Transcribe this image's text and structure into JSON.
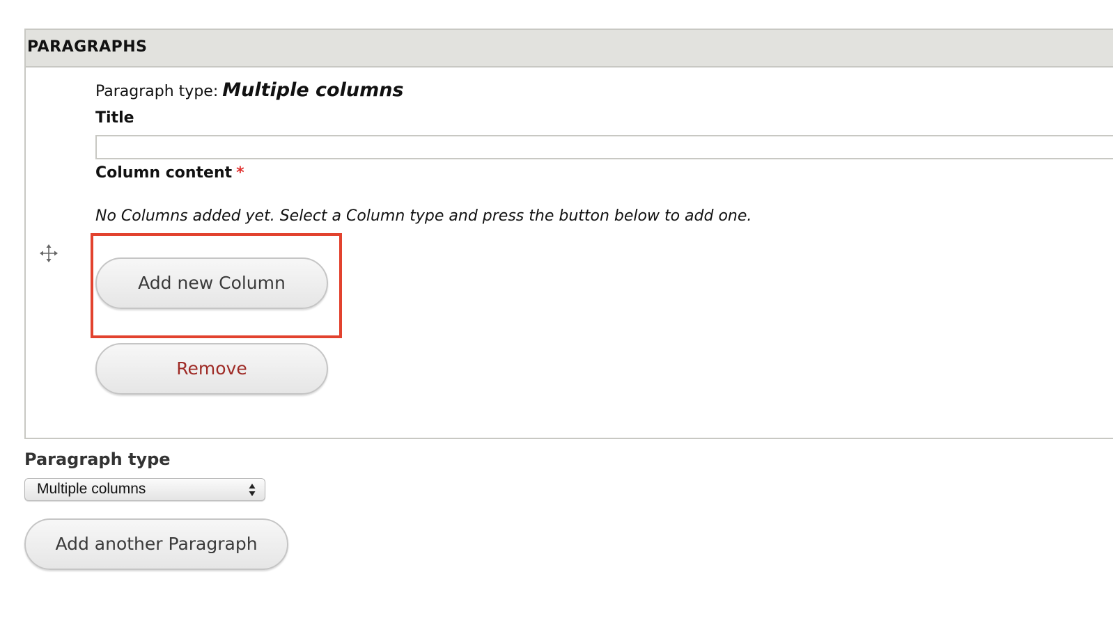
{
  "paragraphs_section": {
    "title": "PARAGRAPHS"
  },
  "paragraph_item": {
    "type_label": "Paragraph type:",
    "type_value": "Multiple columns",
    "title_label": "Title",
    "title_value": "",
    "column_content_label": "Column content",
    "required_marker": "*",
    "empty_message": "No Columns added yet. Select a Column type and press the button below to add one.",
    "add_column_label": "Add new Column",
    "remove_label": "Remove"
  },
  "paragraph_type_selector": {
    "label": "Paragraph type",
    "selected": "Multiple columns"
  },
  "add_paragraph_label": "Add another Paragraph",
  "icons": {
    "drag": "move-drag-icon",
    "select_arrows": "select-updown-icon"
  },
  "colors": {
    "header_bg": "#e2e2de",
    "highlight": "#e2422e",
    "remove_text": "#9e2a25",
    "required": "#e0302e"
  }
}
